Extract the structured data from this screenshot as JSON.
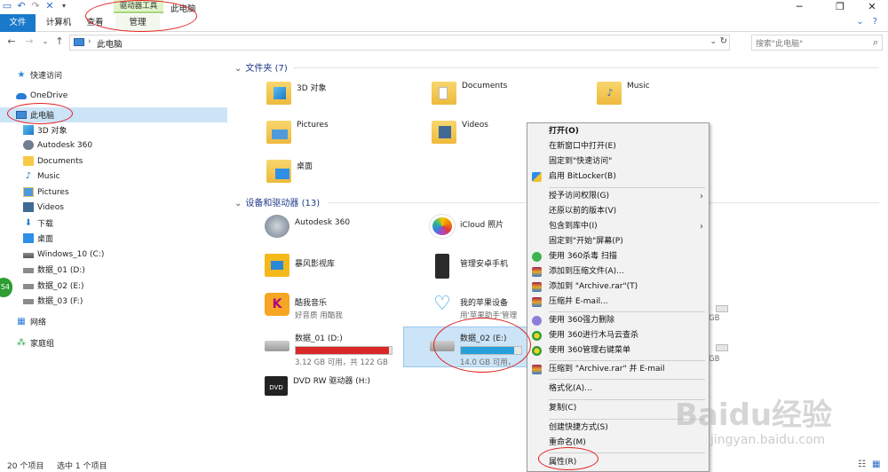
{
  "window": {
    "title": "此电脑",
    "context_tab_label": "驱动器工具"
  },
  "ribbon": {
    "tabs": [
      "文件",
      "计算机",
      "查看",
      "管理"
    ]
  },
  "address": {
    "path": "此电脑",
    "search_placeholder": "搜索\"此电脑\""
  },
  "sidebar": {
    "items": [
      {
        "label": "快速访问",
        "icon": "star-icon"
      },
      {
        "label": "OneDrive",
        "icon": "cloud-icon"
      },
      {
        "label": "此电脑",
        "icon": "computer-icon"
      },
      {
        "label": "3D 对象",
        "icon": "cube-icon"
      },
      {
        "label": "Autodesk 360",
        "icon": "autodesk-icon"
      },
      {
        "label": "Documents",
        "icon": "folder-icon"
      },
      {
        "label": "Music",
        "icon": "music-icon"
      },
      {
        "label": "Pictures",
        "icon": "pictures-icon"
      },
      {
        "label": "Videos",
        "icon": "videos-icon"
      },
      {
        "label": "下载",
        "icon": "download-icon"
      },
      {
        "label": "桌面",
        "icon": "desktop-icon"
      },
      {
        "label": "Windows_10 (C:)",
        "icon": "drive-icon"
      },
      {
        "label": "数据_01 (D:)",
        "icon": "drive-icon"
      },
      {
        "label": "数据_02 (E:)",
        "icon": "drive-icon"
      },
      {
        "label": "数据_03 (F:)",
        "icon": "drive-icon"
      },
      {
        "label": "网络",
        "icon": "network-icon"
      },
      {
        "label": "家庭组",
        "icon": "homegroup-icon"
      }
    ],
    "badge": "54"
  },
  "main": {
    "folders_title": "文件夹 (7)",
    "folders": [
      "3D 对象",
      "Documents",
      "Music",
      "Pictures",
      "Videos",
      "桌面"
    ],
    "devices_title": "设备和驱动器 (13)",
    "devices": [
      {
        "name": "Autodesk 360"
      },
      {
        "name": "iCloud 照片"
      },
      {
        "name": "暴风影视库"
      },
      {
        "name": "管理安卓手机"
      },
      {
        "name": "酷我音乐",
        "sub": "好音质 用酷我"
      },
      {
        "name": "我的苹果设备",
        "sub": "用'苹果助手'管理"
      },
      {
        "name": "数据_01 (D:)",
        "free": "3.12 GB 可用，共 122 GB",
        "used_fraction": 0.97,
        "bar_color": "#da2828"
      },
      {
        "name": "数据_02 (E:)",
        "free": "14.0 GB 可用，",
        "used_fraction": 0.88,
        "bar_color": "#26a0da"
      },
      {
        "name": "DVD RW 驱动器 (H:)"
      }
    ],
    "right_partial": [
      "GB",
      "GB"
    ]
  },
  "context_menu": {
    "items": [
      "打开(O)",
      "在新窗口中打开(E)",
      "固定到\"快速访问\"",
      "启用 BitLocker(B)",
      "授予访问权限(G)",
      "还原以前的版本(V)",
      "包含到库中(I)",
      "固定到\"开始\"屏幕(P)",
      "使用 360杀毒 扫描",
      "添加到压缩文件(A)...",
      "添加到 \"Archive.rar\"(T)",
      "压缩并 E-mail...",
      "使用 360强力删除",
      "使用 360进行木马云查杀",
      "使用 360管理右键菜单",
      "压缩到 \"Archive.rar\" 并 E-mail",
      "格式化(A)...",
      "复制(C)",
      "创建快捷方式(S)",
      "重命名(M)",
      "属性(R)"
    ]
  },
  "status": {
    "count": "20 个项目",
    "selected": "选中 1 个项目"
  },
  "watermark": {
    "brand": "Baidu经验",
    "url": "jingyan.baidu.com"
  }
}
